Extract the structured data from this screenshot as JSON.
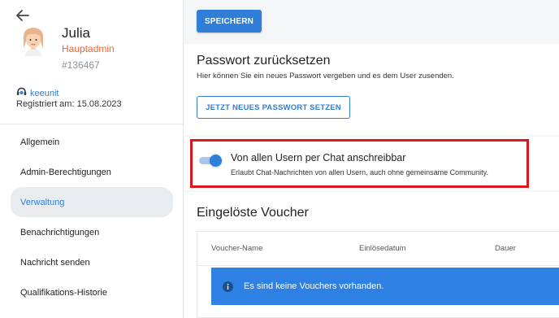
{
  "profile": {
    "name": "Julia",
    "role": "Hauptadmin",
    "user_id": "#136467",
    "organization": "keeunit",
    "registered": "Registriert am: 15.08.2023"
  },
  "sidebar": {
    "items": [
      {
        "label": "Allgemein",
        "active": false
      },
      {
        "label": "Admin-Berechtigungen",
        "active": false
      },
      {
        "label": "Verwaltung",
        "active": true
      },
      {
        "label": "Benachrichtigungen",
        "active": false
      },
      {
        "label": "Nachricht senden",
        "active": false
      },
      {
        "label": "Qualifikations-Historie",
        "active": false
      }
    ]
  },
  "toolbar": {
    "save_label": "SPEICHERN"
  },
  "password_section": {
    "title": "Passwort zurücksetzen",
    "description": "Hier können Sie ein neues Passwort vergeben und es dem User zusenden.",
    "button_label": "JETZT NEUES PASSWORT SETZEN"
  },
  "chat_setting": {
    "title": "Von allen Usern per Chat anschreibbar",
    "description": "Erlaubt Chat-Nachrichten von allen Usern, auch ohne gemeinsame Community.",
    "enabled": true
  },
  "vouchers": {
    "title": "Eingelöste Voucher",
    "columns": [
      "Voucher-Name",
      "Einlösedatum",
      "Dauer"
    ],
    "empty_message": "Es sind keine Vouchers vorhanden."
  },
  "colors": {
    "accent": "#2f7ed8",
    "role": "#e8683a",
    "highlight": "#e0141c"
  },
  "icons": [
    "back-arrow-icon",
    "avatar",
    "keeunit-logo-icon",
    "info-icon"
  ]
}
